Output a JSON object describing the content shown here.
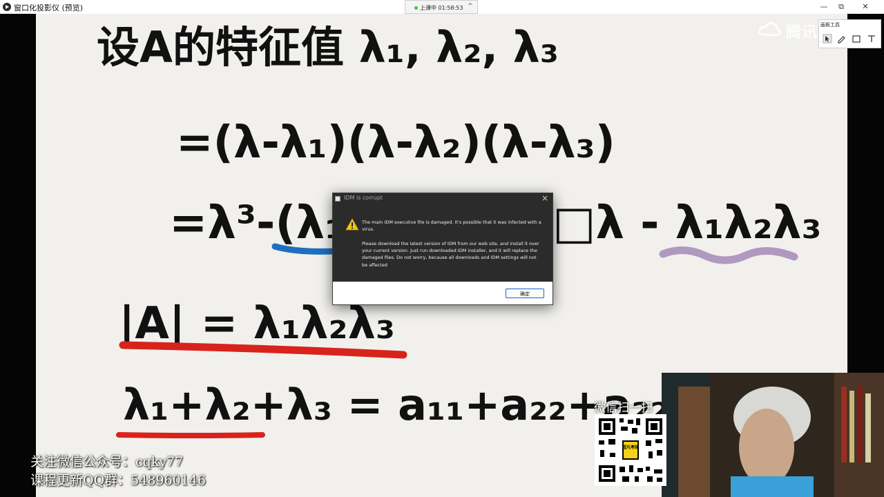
{
  "window": {
    "title": "窗口化投影仪 (预览)",
    "class_status": "上课中 01:58:53",
    "chevron": "^",
    "minimize": "—",
    "restore": "⧉",
    "close": "✕"
  },
  "watermark": {
    "text": "腾讯"
  },
  "draw_toolbar": {
    "title": "画板工具"
  },
  "board": {
    "line1": "设A的特征值 λ₁, λ₂, λ₃",
    "line2": "=(λ-λ₁)(λ-λ₂)(λ-λ₃)",
    "line3_left": "=λ³-(λ₁",
    "line3_right": "□λ - λ₁λ₂λ₃",
    "line4": "|A| = λ₁λ₂λ₃",
    "line5": "λ₁+λ₂+λ₃ = a₁₁+a₂₂+a₂₂"
  },
  "captions": {
    "line1": "关注微信公众号：cqky77",
    "line2": "课程更新QQ群：548960146"
  },
  "qr": {
    "label": "微信扫一扫",
    "center_text": "超凡考研"
  },
  "dialog": {
    "title": "IDM is corrupt",
    "close": "×",
    "message1": "The main IDM executive file is damaged. It's possible that it was infected with a virus.",
    "message2": "Please download the latest version of IDM from our web site, and install it over your current version. Just run downloaded IDM installer, and it will replace the damaged files. Do not worry, because all downloads and IDM settings will not be affected",
    "ok_label": "确定"
  },
  "colors": {
    "ink": "#111111",
    "blue_underline": "#1d6fc0",
    "purple_underline": "#a48ab8",
    "red_underline": "#d8231c",
    "dialog_bg": "#2b2b2b",
    "ok_border": "#1a64c4"
  }
}
